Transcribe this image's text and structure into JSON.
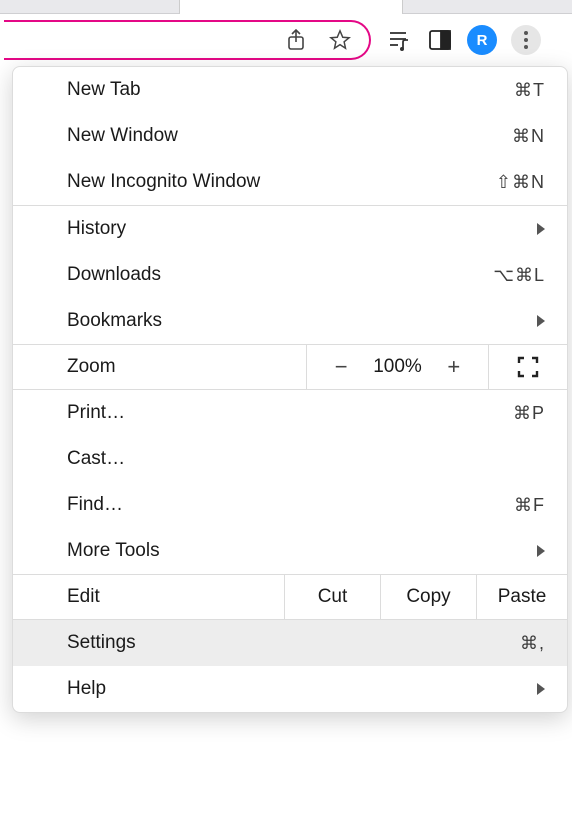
{
  "toolbar": {
    "avatar_initial": "R"
  },
  "menu": {
    "new_tab": {
      "label": "New Tab",
      "shortcut": "⌘T"
    },
    "new_window": {
      "label": "New Window",
      "shortcut": "⌘N"
    },
    "new_incognito": {
      "label": "New Incognito Window",
      "shortcut": "⇧⌘N"
    },
    "history": {
      "label": "History"
    },
    "downloads": {
      "label": "Downloads",
      "shortcut": "⌥⌘L"
    },
    "bookmarks": {
      "label": "Bookmarks"
    },
    "zoom": {
      "label": "Zoom",
      "value": "100%"
    },
    "print": {
      "label": "Print…",
      "shortcut": "⌘P"
    },
    "cast": {
      "label": "Cast…"
    },
    "find": {
      "label": "Find…",
      "shortcut": "⌘F"
    },
    "more_tools": {
      "label": "More Tools"
    },
    "edit": {
      "label": "Edit",
      "cut": "Cut",
      "copy": "Copy",
      "paste": "Paste"
    },
    "settings": {
      "label": "Settings",
      "shortcut": "⌘,"
    },
    "help": {
      "label": "Help"
    }
  }
}
